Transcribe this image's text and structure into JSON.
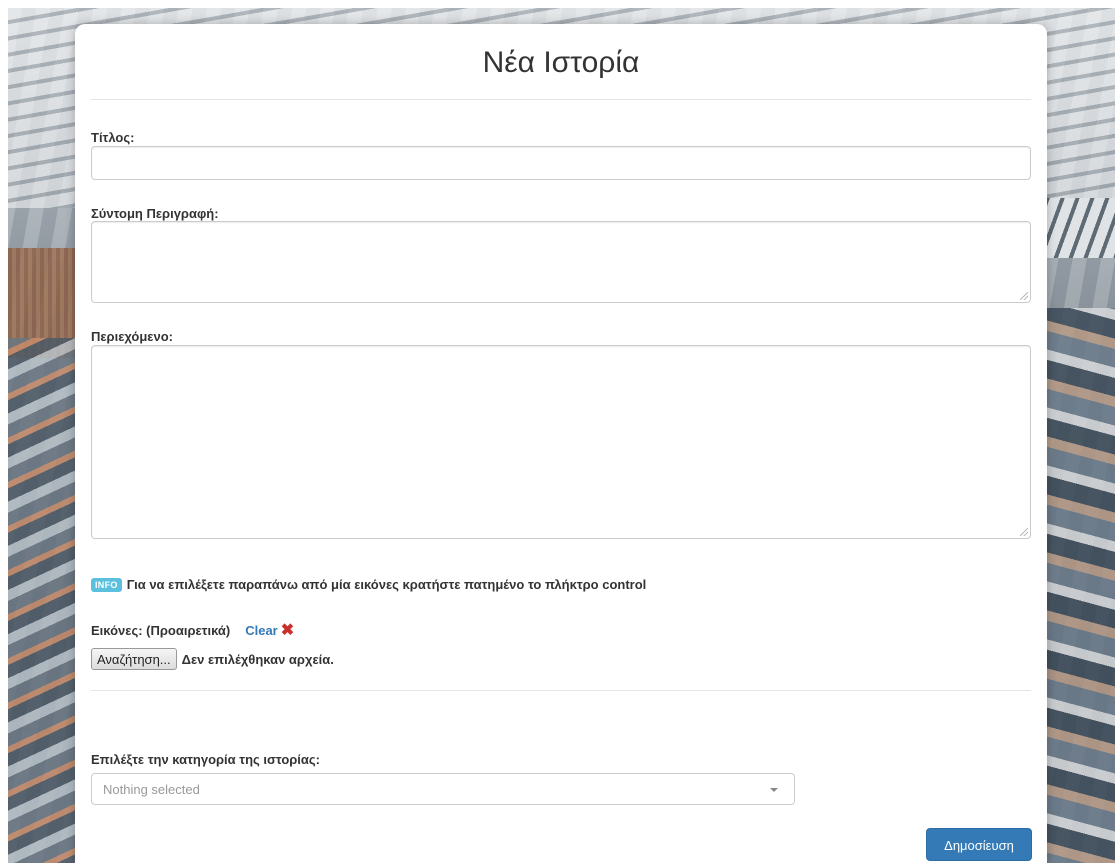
{
  "page": {
    "title": "Νέα Ιστορία"
  },
  "form": {
    "title_label": "Τίτλος:",
    "title_value": "",
    "summary_label": "Σύντομη Περιγραφή:",
    "summary_value": "",
    "content_label": "Περιεχόμενο:",
    "content_value": "",
    "info_badge": "INFO",
    "info_text": "Για να επιλέξετε παραπάνω από μία εικόνες κρατήστε πατημένο το πλήκτρο control",
    "images_label": "Εικόνες: (Προαιρετικά)",
    "clear_label": "Clear",
    "clear_icon": "✖",
    "file_button_label": "Αναζήτηση...",
    "file_status": "Δεν επιλέχθηκαν αρχεία.",
    "category_label": "Επιλέξτε την κατηγορία της ιστορίας:",
    "category_placeholder": "Nothing selected",
    "submit_label": "Δημοσίευση"
  },
  "colors": {
    "primary": "#337ab7",
    "info": "#5bc0de",
    "danger": "#c9302c"
  }
}
